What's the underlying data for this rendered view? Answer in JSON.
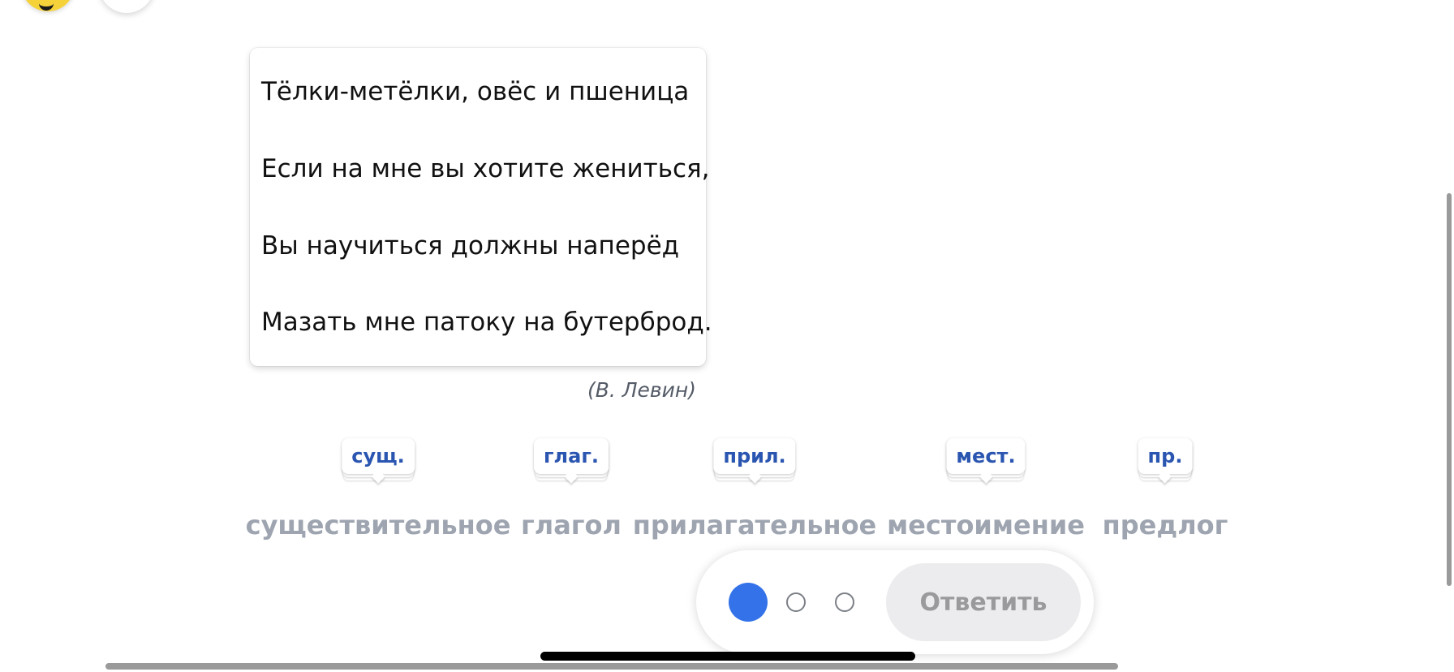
{
  "poem": {
    "lines": [
      "Тёлки-метёлки, овёс и пшеница",
      "Если на мне вы хотите жениться,",
      "Вы научиться должны наперёд",
      "Мазать мне патоку на бутерброд."
    ],
    "author": "(В. Левин)"
  },
  "parts_of_speech": [
    {
      "tag": "сущ.",
      "label": "существительное"
    },
    {
      "tag": "глаг.",
      "label": "глагол"
    },
    {
      "tag": "прил.",
      "label": "прилагательное"
    },
    {
      "tag": "мест.",
      "label": "местоимение"
    },
    {
      "tag": "пр.",
      "label": "предлог"
    }
  ],
  "controls": {
    "answer_label": "Ответить",
    "step_total": 3,
    "step_current": 1
  },
  "colors": {
    "accent": "#3372e8",
    "tag_text": "#2a55b0",
    "label_text": "#9ea5b0",
    "avatar_yellow": "#f6d23a"
  }
}
